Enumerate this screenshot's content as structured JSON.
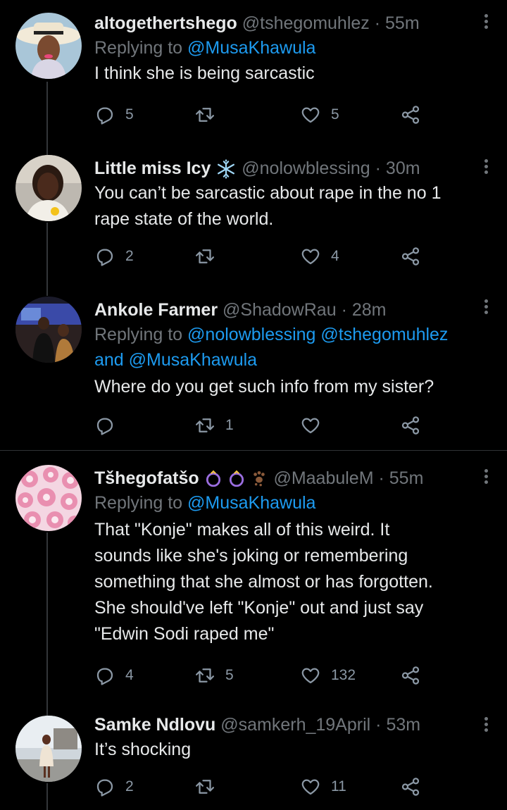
{
  "tweets": [
    {
      "name": "altogethertshego",
      "handle": "@tshegomuhlez",
      "time": "55m",
      "replying_label": "Replying to",
      "mentions": [
        "@MusaKhawula"
      ],
      "text_lines": [
        "I think she is being sarcastic"
      ],
      "counts": {
        "reply": "5",
        "retweet": "",
        "like": "5"
      }
    },
    {
      "name": "Little miss Icy",
      "name_emoji": "snowflake-icon",
      "handle": "@nolowblessing",
      "time": "30m",
      "text_lines": [
        "You can’t be sarcastic about rape in the no 1",
        "rape state of the world."
      ],
      "counts": {
        "reply": "2",
        "retweet": "",
        "like": "4"
      }
    },
    {
      "name": "Ankole Farmer",
      "handle": "@ShadowRau",
      "time": "28m",
      "replying_label": "Replying to",
      "mentions": [
        "@nolowblessing",
        "@tshegomuhlez",
        "@MusaKhawula"
      ],
      "mention_joiner": "and",
      "text_lines": [
        "Where do you get such info from my sister?"
      ],
      "counts": {
        "reply": "",
        "retweet": "1",
        "like": ""
      }
    },
    {
      "name": "Tšhegofatšo",
      "name_emoji": [
        "purple-ring-icon",
        "purple-ring-icon",
        "paw-prints-icon"
      ],
      "handle": "@MaabuleM",
      "time": "55m",
      "replying_label": "Replying to",
      "mentions": [
        "@MusaKhawula"
      ],
      "text_lines": [
        "That \"Konje\" makes all of this weird. It",
        "sounds like she's joking or remembering",
        "something that she almost or has forgotten.",
        "She should've left \"Konje\" out and just say",
        "\"Edwin Sodi raped me\""
      ],
      "counts": {
        "reply": "4",
        "retweet": "5",
        "like": "132"
      }
    },
    {
      "name": "Samke Ndlovu",
      "handle": "@samkerh_19April",
      "time": "53m",
      "text_lines": [
        "It’s shocking"
      ],
      "counts": {
        "reply": "2",
        "retweet": "",
        "like": "11"
      }
    }
  ],
  "dot_separator": "·",
  "colors": {
    "background": "#000000",
    "text": "#e7e9ea",
    "muted": "#71767b",
    "mention": "#1d9bf0",
    "thread_line": "#333639",
    "icon": "#8b98a5"
  }
}
